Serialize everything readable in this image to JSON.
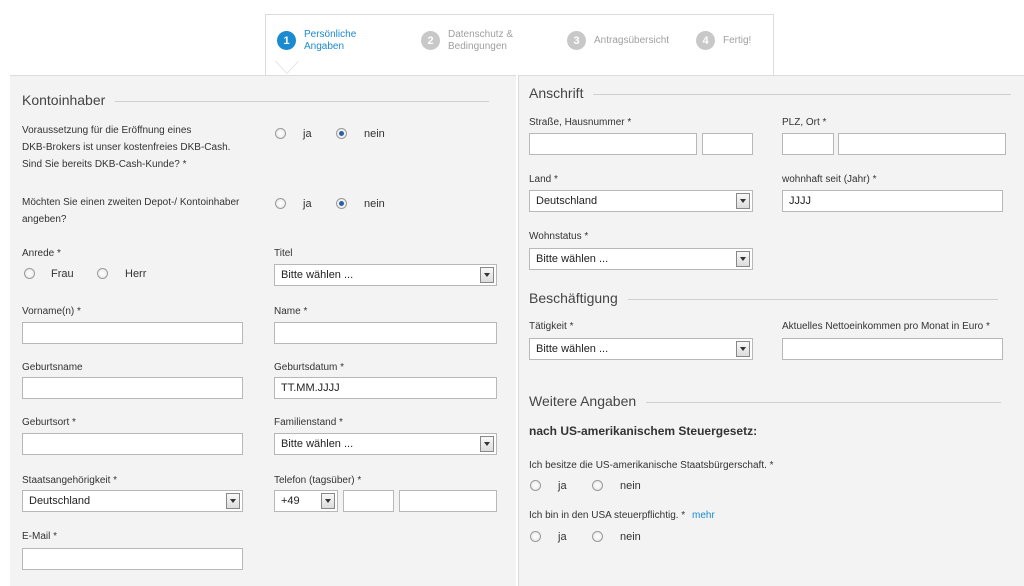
{
  "steps": [
    {
      "num": "1",
      "label": "Persönliche\nAngaben"
    },
    {
      "num": "2",
      "label": "Datenschutz &\nBedingungen"
    },
    {
      "num": "3",
      "label": "Antragsübersicht"
    },
    {
      "num": "4",
      "label": "Fertig!"
    }
  ],
  "left": {
    "section_title": "Kontoinhaber",
    "q1": "Voraussetzung für die Eröffnung eines\nDKB-Brokers ist unser kostenfreies DKB-Cash.\nSind Sie bereits DKB-Cash-Kunde? *",
    "q2": "Möchten Sie einen zweiten Depot-/ Kontoinhaber\nangeben?",
    "ja": "ja",
    "nein": "nein",
    "anrede_label": "Anrede *",
    "frau": "Frau",
    "herr": "Herr",
    "titel_label": "Titel",
    "titel_value": "Bitte wählen ...",
    "vorname_label": "Vorname(n) *",
    "name_label": "Name *",
    "geburtsname_label": "Geburtsname",
    "geburtsdatum_label": "Geburtsdatum *",
    "geburtsdatum_value": "TT.MM.JJJJ",
    "geburtsort_label": "Geburtsort *",
    "familienstand_label": "Familienstand *",
    "familienstand_value": "Bitte wählen ...",
    "staat_label": "Staatsangehörigkeit *",
    "staat_value": "Deutschland",
    "telefon_label": "Telefon (tagsüber) *",
    "telefon_prefix": "+49",
    "email_label": "E-Mail *"
  },
  "right": {
    "anschrift_title": "Anschrift",
    "strasse_label": "Straße, Hausnummer *",
    "plz_label": "PLZ, Ort *",
    "land_label": "Land *",
    "land_value": "Deutschland",
    "wohnhaft_label": "wohnhaft seit (Jahr) *",
    "wohnhaft_value": "JJJJ",
    "wohnstatus_label": "Wohnstatus *",
    "wohnstatus_value": "Bitte wählen ...",
    "beschaeftigung_title": "Beschäftigung",
    "taetigkeit_label": "Tätigkeit *",
    "taetigkeit_value": "Bitte wählen ...",
    "netto_label": "Aktuelles Nettoeinkommen pro Monat in Euro *",
    "weitere_title": "Weitere Angaben",
    "us_heading": "nach US-amerikanischem Steuergesetz:",
    "us_q1": "Ich besitze die US-amerikanische Staatsbürgerschaft. *",
    "us_q2": "Ich bin in den USA steuerpflichtig. *",
    "mehr": "mehr",
    "ja": "ja",
    "nein": "nein"
  },
  "colors": {
    "accent": "#1a8bd1",
    "panel_bg": "#f3f3f3",
    "inactive": "#c8c8c8"
  }
}
